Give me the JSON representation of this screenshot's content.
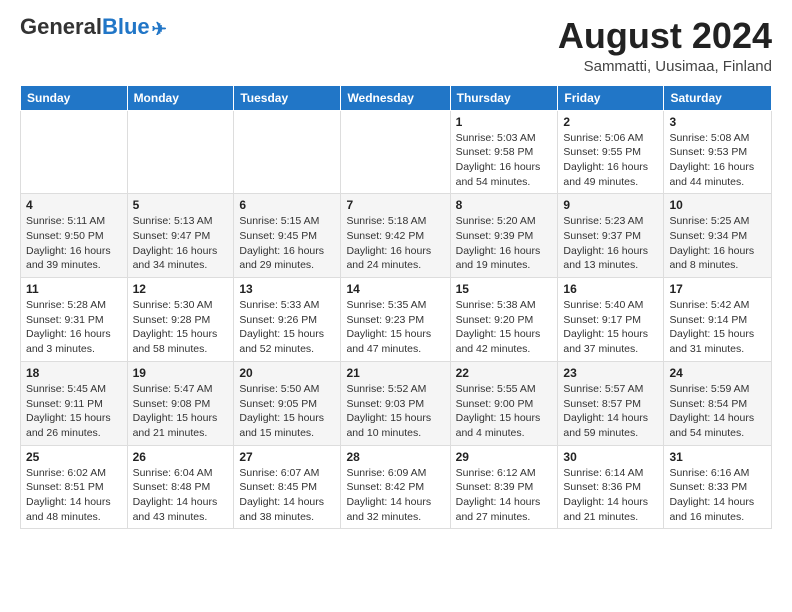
{
  "header": {
    "logo_general": "General",
    "logo_blue": "Blue",
    "month_year": "August 2024",
    "location": "Sammatti, Uusimaa, Finland"
  },
  "weekdays": [
    "Sunday",
    "Monday",
    "Tuesday",
    "Wednesday",
    "Thursday",
    "Friday",
    "Saturday"
  ],
  "weeks": [
    [
      {
        "day": "",
        "info": ""
      },
      {
        "day": "",
        "info": ""
      },
      {
        "day": "",
        "info": ""
      },
      {
        "day": "",
        "info": ""
      },
      {
        "day": "1",
        "info": "Sunrise: 5:03 AM\nSunset: 9:58 PM\nDaylight: 16 hours\nand 54 minutes."
      },
      {
        "day": "2",
        "info": "Sunrise: 5:06 AM\nSunset: 9:55 PM\nDaylight: 16 hours\nand 49 minutes."
      },
      {
        "day": "3",
        "info": "Sunrise: 5:08 AM\nSunset: 9:53 PM\nDaylight: 16 hours\nand 44 minutes."
      }
    ],
    [
      {
        "day": "4",
        "info": "Sunrise: 5:11 AM\nSunset: 9:50 PM\nDaylight: 16 hours\nand 39 minutes."
      },
      {
        "day": "5",
        "info": "Sunrise: 5:13 AM\nSunset: 9:47 PM\nDaylight: 16 hours\nand 34 minutes."
      },
      {
        "day": "6",
        "info": "Sunrise: 5:15 AM\nSunset: 9:45 PM\nDaylight: 16 hours\nand 29 minutes."
      },
      {
        "day": "7",
        "info": "Sunrise: 5:18 AM\nSunset: 9:42 PM\nDaylight: 16 hours\nand 24 minutes."
      },
      {
        "day": "8",
        "info": "Sunrise: 5:20 AM\nSunset: 9:39 PM\nDaylight: 16 hours\nand 19 minutes."
      },
      {
        "day": "9",
        "info": "Sunrise: 5:23 AM\nSunset: 9:37 PM\nDaylight: 16 hours\nand 13 minutes."
      },
      {
        "day": "10",
        "info": "Sunrise: 5:25 AM\nSunset: 9:34 PM\nDaylight: 16 hours\nand 8 minutes."
      }
    ],
    [
      {
        "day": "11",
        "info": "Sunrise: 5:28 AM\nSunset: 9:31 PM\nDaylight: 16 hours\nand 3 minutes."
      },
      {
        "day": "12",
        "info": "Sunrise: 5:30 AM\nSunset: 9:28 PM\nDaylight: 15 hours\nand 58 minutes."
      },
      {
        "day": "13",
        "info": "Sunrise: 5:33 AM\nSunset: 9:26 PM\nDaylight: 15 hours\nand 52 minutes."
      },
      {
        "day": "14",
        "info": "Sunrise: 5:35 AM\nSunset: 9:23 PM\nDaylight: 15 hours\nand 47 minutes."
      },
      {
        "day": "15",
        "info": "Sunrise: 5:38 AM\nSunset: 9:20 PM\nDaylight: 15 hours\nand 42 minutes."
      },
      {
        "day": "16",
        "info": "Sunrise: 5:40 AM\nSunset: 9:17 PM\nDaylight: 15 hours\nand 37 minutes."
      },
      {
        "day": "17",
        "info": "Sunrise: 5:42 AM\nSunset: 9:14 PM\nDaylight: 15 hours\nand 31 minutes."
      }
    ],
    [
      {
        "day": "18",
        "info": "Sunrise: 5:45 AM\nSunset: 9:11 PM\nDaylight: 15 hours\nand 26 minutes."
      },
      {
        "day": "19",
        "info": "Sunrise: 5:47 AM\nSunset: 9:08 PM\nDaylight: 15 hours\nand 21 minutes."
      },
      {
        "day": "20",
        "info": "Sunrise: 5:50 AM\nSunset: 9:05 PM\nDaylight: 15 hours\nand 15 minutes."
      },
      {
        "day": "21",
        "info": "Sunrise: 5:52 AM\nSunset: 9:03 PM\nDaylight: 15 hours\nand 10 minutes."
      },
      {
        "day": "22",
        "info": "Sunrise: 5:55 AM\nSunset: 9:00 PM\nDaylight: 15 hours\nand 4 minutes."
      },
      {
        "day": "23",
        "info": "Sunrise: 5:57 AM\nSunset: 8:57 PM\nDaylight: 14 hours\nand 59 minutes."
      },
      {
        "day": "24",
        "info": "Sunrise: 5:59 AM\nSunset: 8:54 PM\nDaylight: 14 hours\nand 54 minutes."
      }
    ],
    [
      {
        "day": "25",
        "info": "Sunrise: 6:02 AM\nSunset: 8:51 PM\nDaylight: 14 hours\nand 48 minutes."
      },
      {
        "day": "26",
        "info": "Sunrise: 6:04 AM\nSunset: 8:48 PM\nDaylight: 14 hours\nand 43 minutes."
      },
      {
        "day": "27",
        "info": "Sunrise: 6:07 AM\nSunset: 8:45 PM\nDaylight: 14 hours\nand 38 minutes."
      },
      {
        "day": "28",
        "info": "Sunrise: 6:09 AM\nSunset: 8:42 PM\nDaylight: 14 hours\nand 32 minutes."
      },
      {
        "day": "29",
        "info": "Sunrise: 6:12 AM\nSunset: 8:39 PM\nDaylight: 14 hours\nand 27 minutes."
      },
      {
        "day": "30",
        "info": "Sunrise: 6:14 AM\nSunset: 8:36 PM\nDaylight: 14 hours\nand 21 minutes."
      },
      {
        "day": "31",
        "info": "Sunrise: 6:16 AM\nSunset: 8:33 PM\nDaylight: 14 hours\nand 16 minutes."
      }
    ]
  ]
}
